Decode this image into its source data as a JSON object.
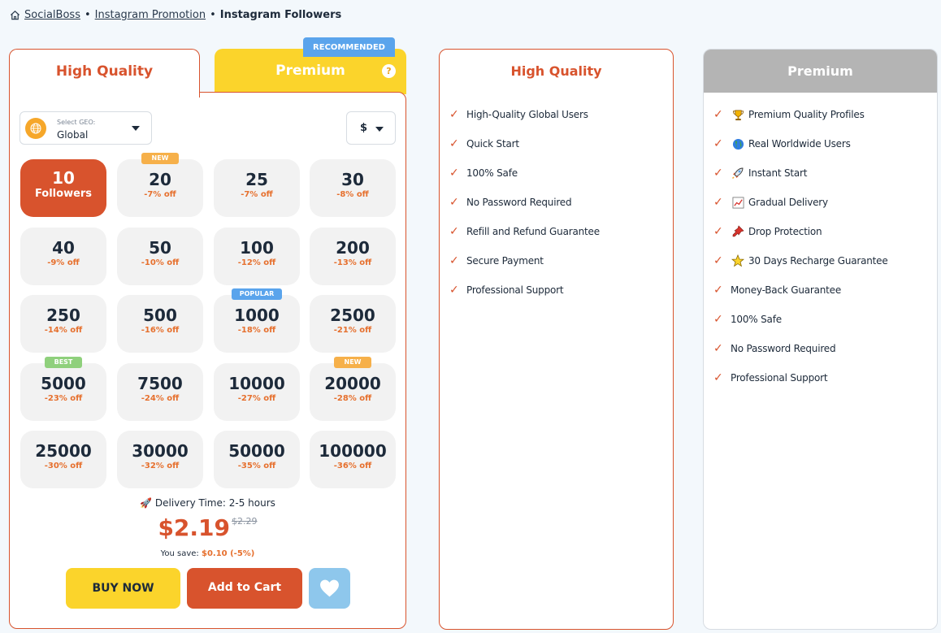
{
  "breadcrumb": {
    "home": "SocialBoss",
    "category": "Instagram Promotion",
    "current": "Instagram Followers",
    "separator": "•"
  },
  "tabs": {
    "high_quality": "High Quality",
    "premium": "Premium",
    "recommended_badge": "RECOMMENDED",
    "help": "?"
  },
  "geo": {
    "label": "Select GEO:",
    "value": "Global"
  },
  "currency": "$",
  "packages": [
    {
      "qty": "10",
      "unit": "Followers",
      "discount": "",
      "badge": "",
      "selected": true
    },
    {
      "qty": "20",
      "discount": "-7% off",
      "badge": "NEW"
    },
    {
      "qty": "25",
      "discount": "-7% off",
      "badge": ""
    },
    {
      "qty": "30",
      "discount": "-8% off",
      "badge": ""
    },
    {
      "qty": "40",
      "discount": "-9% off",
      "badge": ""
    },
    {
      "qty": "50",
      "discount": "-10% off",
      "badge": ""
    },
    {
      "qty": "100",
      "discount": "-12% off",
      "badge": ""
    },
    {
      "qty": "200",
      "discount": "-13% off",
      "badge": ""
    },
    {
      "qty": "250",
      "discount": "-14% off",
      "badge": ""
    },
    {
      "qty": "500",
      "discount": "-16% off",
      "badge": ""
    },
    {
      "qty": "1000",
      "discount": "-18% off",
      "badge": "POPULAR"
    },
    {
      "qty": "2500",
      "discount": "-21% off",
      "badge": ""
    },
    {
      "qty": "5000",
      "discount": "-23% off",
      "badge": "BEST"
    },
    {
      "qty": "7500",
      "discount": "-24% off",
      "badge": ""
    },
    {
      "qty": "10000",
      "discount": "-27% off",
      "badge": ""
    },
    {
      "qty": "20000",
      "discount": "-28% off",
      "badge": "NEW"
    },
    {
      "qty": "25000",
      "discount": "-30% off",
      "badge": ""
    },
    {
      "qty": "30000",
      "discount": "-32% off",
      "badge": ""
    },
    {
      "qty": "50000",
      "discount": "-35% off",
      "badge": ""
    },
    {
      "qty": "100000",
      "discount": "-36% off",
      "badge": ""
    }
  ],
  "badge_colors": {
    "NEW": "#f6b04a",
    "POPULAR": "#5aa4ec",
    "BEST": "#8fd07c"
  },
  "delivery": "Delivery Time: 2-5 hours",
  "price": {
    "current": "$2.19",
    "old": "$2.29",
    "save_label": "You save:",
    "save_value": "$0.10 (-5%)"
  },
  "buttons": {
    "buy_now": "BUY NOW",
    "add_to_cart": "Add to Cart"
  },
  "high_quality_features": {
    "title": "High Quality",
    "items": [
      "High-Quality Global Users",
      "Quick Start",
      "100% Safe",
      "No Password Required",
      "Refill and Refund Guarantee",
      "Secure Payment",
      "Professional Support"
    ]
  },
  "premium_features": {
    "title": "Premium",
    "items": [
      {
        "text": "Premium Quality Profiles",
        "icon": "trophy-icon"
      },
      {
        "text": "Real Worldwide Users",
        "icon": "globe-icon"
      },
      {
        "text": "Instant Start",
        "icon": "rocket-icon"
      },
      {
        "text": "Gradual Delivery",
        "icon": "chart-icon"
      },
      {
        "text": "Drop Protection",
        "icon": "pin-icon"
      },
      {
        "text": "30 Days Recharge Guarantee",
        "icon": "star-icon"
      },
      {
        "text": "Money-Back Guarantee",
        "icon": ""
      },
      {
        "text": "100% Safe",
        "icon": ""
      },
      {
        "text": "No Password Required",
        "icon": ""
      },
      {
        "text": "Professional Support",
        "icon": ""
      }
    ]
  },
  "colors": {
    "accent": "#d8532d",
    "yellow": "#fbd42b",
    "blue": "#5aa4ec",
    "discount": "#e6702e"
  }
}
